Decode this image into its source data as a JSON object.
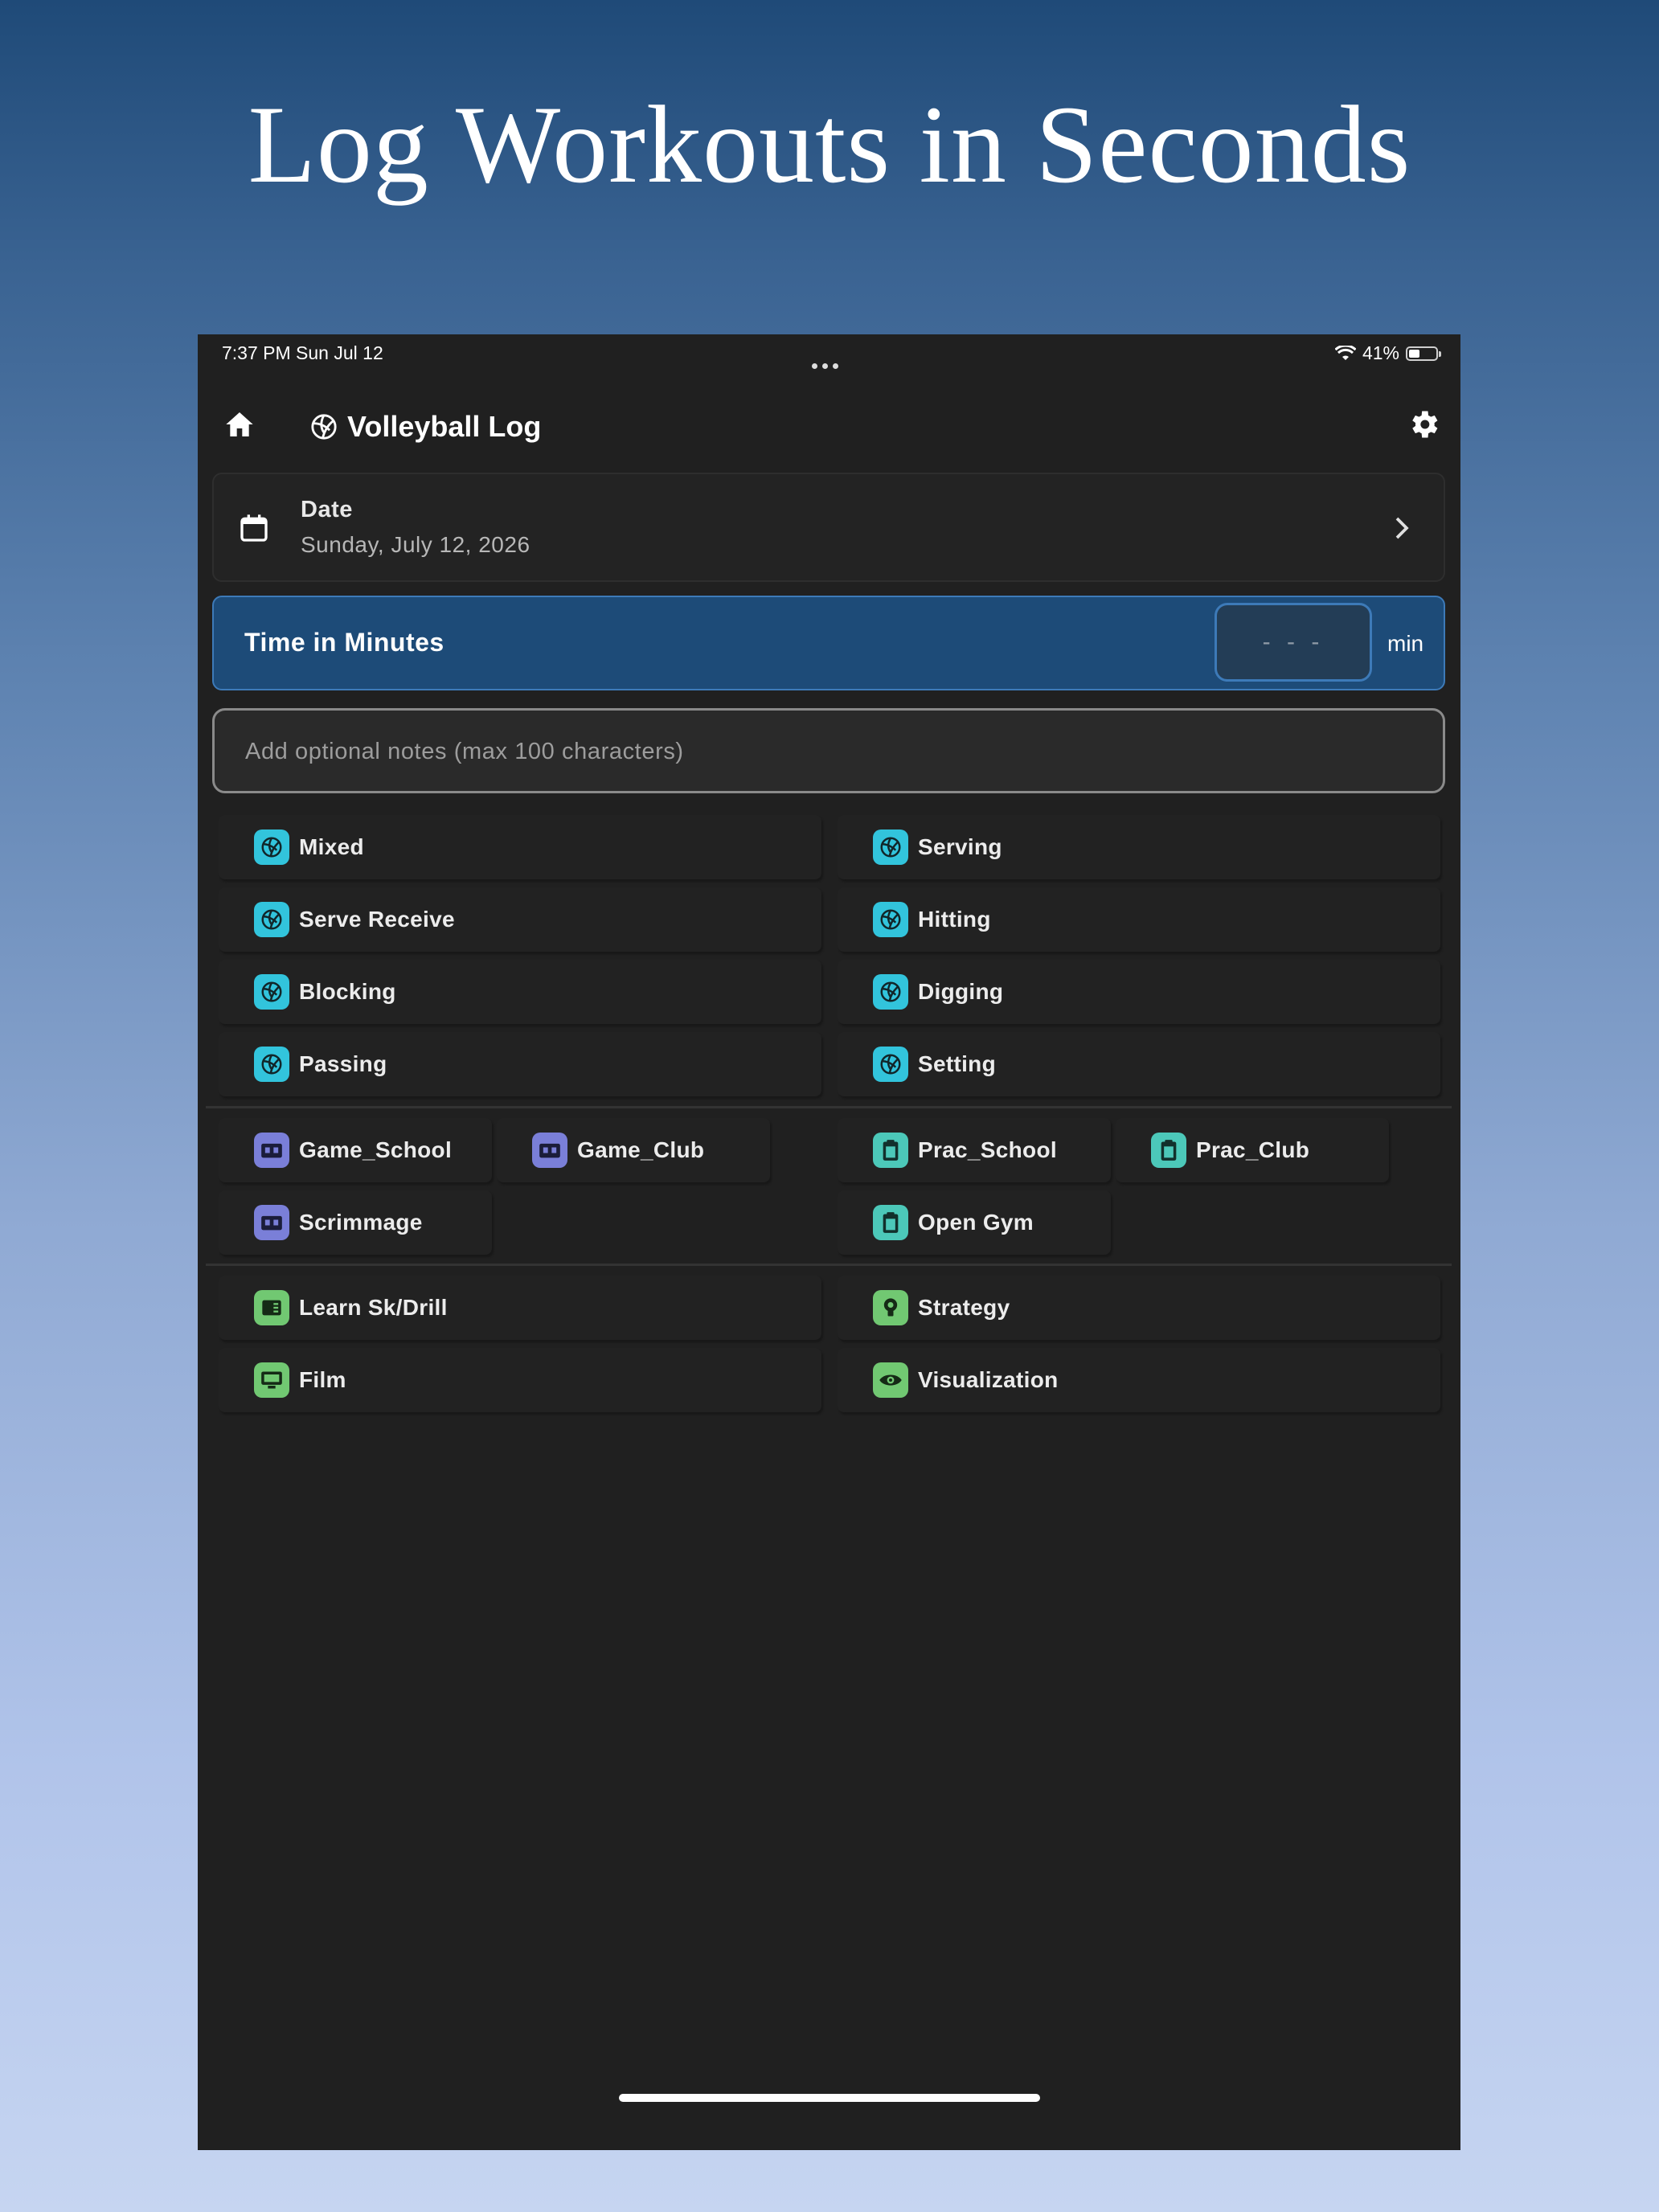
{
  "headline": "Log Workouts in Seconds",
  "status": {
    "time": "7:37 PM  Sun Jul 12",
    "battery": "41%",
    "battery_fraction": 0.41
  },
  "app": {
    "title": "Volleyball Log"
  },
  "date_card": {
    "label": "Date",
    "value": "Sunday, July 12, 2026"
  },
  "time_card": {
    "label": "Time in Minutes",
    "placeholder": "- - -",
    "unit": "min"
  },
  "notes": {
    "placeholder": "Add optional notes (max 100 characters)"
  },
  "skills": [
    "Mixed",
    "Serving",
    "Serve Receive",
    "Hitting",
    "Blocking",
    "Digging",
    "Passing",
    "Setting"
  ],
  "sessions": {
    "games": [
      "Game_School",
      "Game_Club",
      "Scrimmage"
    ],
    "practices": [
      "Prac_School",
      "Prac_Club",
      "Open Gym"
    ]
  },
  "training": [
    "Learn Sk/Drill",
    "Strategy",
    "Film",
    "Visualization"
  ],
  "colors": {
    "skill_icon": "#32c4dc",
    "game_icon": "#7a7fd8",
    "practice_icon": "#4cc8b9",
    "training_icon": "#71c872",
    "time_card": "#1d4b78"
  }
}
